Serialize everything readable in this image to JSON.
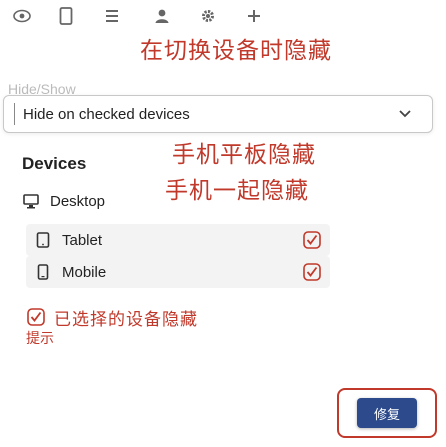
{
  "toolbar": {
    "icons": [
      "eye-icon",
      "tablet-icon",
      "align-icon",
      "user-icon",
      "gear-icon",
      "plus-icon"
    ]
  },
  "banner": {
    "text": "在切换设备时隐藏"
  },
  "ghost_label": "Hide/Show",
  "select": {
    "value": "Hide on checked devices"
  },
  "devices": {
    "title": "Devices",
    "desktop": "Desktop",
    "tablet": "Tablet",
    "mobile": "Mobile"
  },
  "notes": {
    "line1": "手机平板隐藏",
    "line2": "手机一起隐藏",
    "check_text": "已选择的设备隐藏",
    "small": "提示"
  },
  "fixed_button": {
    "label": "修复"
  },
  "colors": {
    "accent": "#c0392b",
    "button": "#2c4a8c"
  }
}
